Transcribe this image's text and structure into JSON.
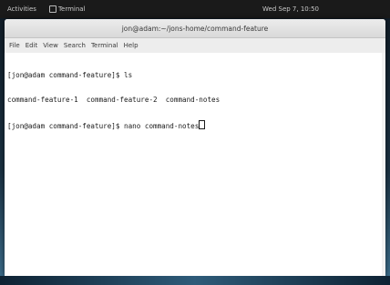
{
  "topbar": {
    "activities_label": "Activities",
    "app_label": "Terminal",
    "clock": "Wed Sep  7, 10:50"
  },
  "window": {
    "title": "jon@adam:~/jons-home/command-feature"
  },
  "menubar": {
    "items": [
      "File",
      "Edit",
      "View",
      "Search",
      "Terminal",
      "Help"
    ]
  },
  "terminal": {
    "lines": [
      "[jon@adam command-feature]$ ls",
      "command-feature-1  command-feature-2  command-notes",
      "[jon@adam command-feature]$ nano command-notes"
    ]
  },
  "colors": {
    "topbar_bg": "#1a1a1a",
    "terminal_bg": "#ffffff",
    "terminal_fg": "#1a1a1a"
  }
}
